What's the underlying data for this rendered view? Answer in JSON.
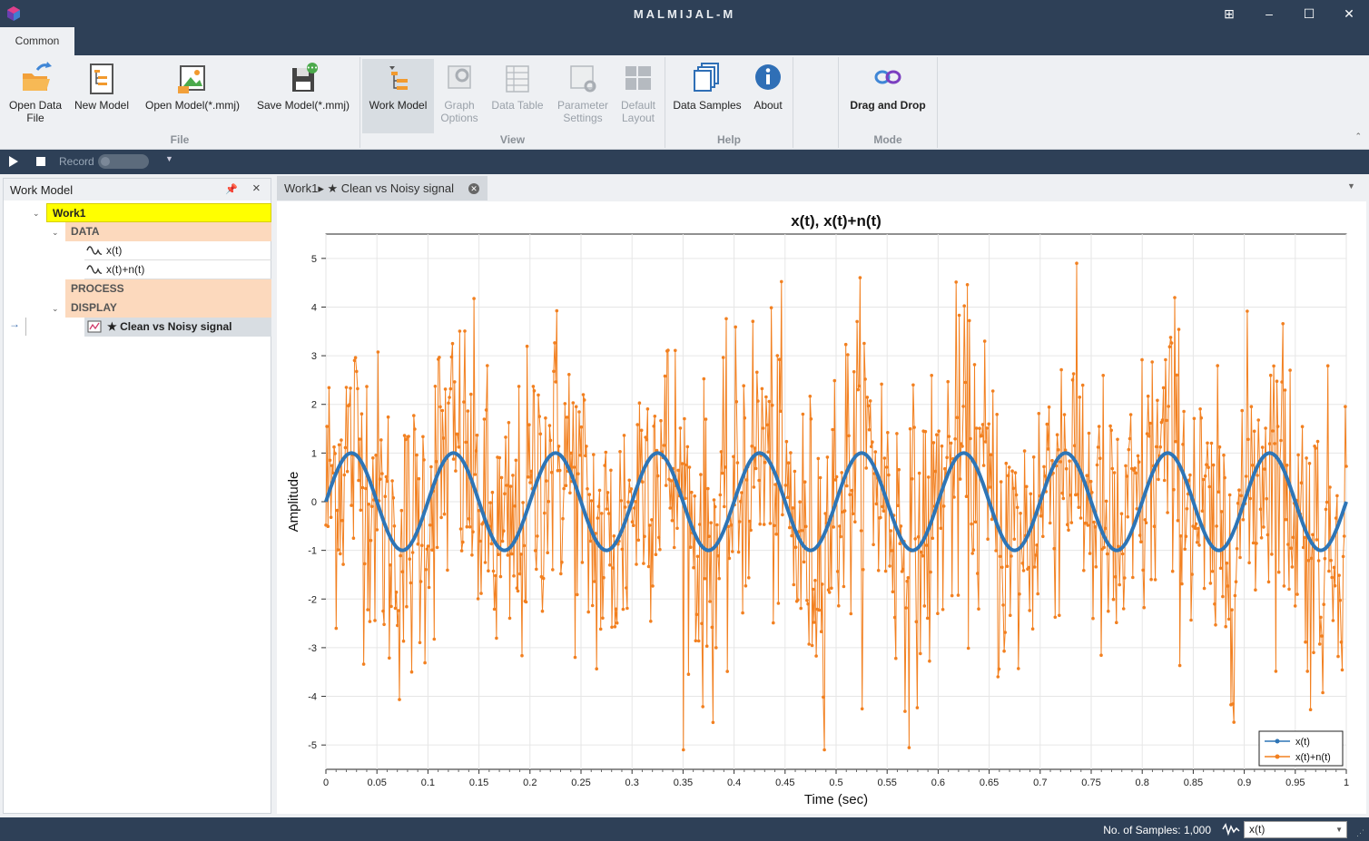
{
  "window": {
    "title": "MALMIJAL-M"
  },
  "ribbon": {
    "tab": "Common",
    "file_group": {
      "label": "File",
      "open_data": [
        "Open Data",
        "File"
      ],
      "new_model": "New Model",
      "open_model": "Open Model(*.mmj)",
      "save_model": "Save Model(*.mmj)"
    },
    "view_group": {
      "label": "View",
      "work_model": "Work Model",
      "graph_options": [
        "Graph",
        "Options"
      ],
      "data_table": "Data Table",
      "parameter_settings": [
        "Parameter",
        "Settings"
      ],
      "default_layout": [
        "Default",
        "Layout"
      ]
    },
    "help_group": {
      "label": "Help",
      "data_samples": "Data Samples",
      "about": "About"
    },
    "mode_group": {
      "label": "Mode",
      "drag_and_drop": "Drag and Drop"
    }
  },
  "record_bar": {
    "record_label": "Record"
  },
  "work_model_panel": {
    "title": "Work Model",
    "tree": {
      "root": "Work1",
      "data": "DATA",
      "data_items": [
        "x(t)",
        "x(t)+n(t)"
      ],
      "process": "PROCESS",
      "display": "DISPLAY",
      "display_items": [
        "★ Clean vs Noisy signal"
      ]
    }
  },
  "document_tab": {
    "label": "Work1▸ ★ Clean vs Noisy signal"
  },
  "status_bar": {
    "samples_text": "No. of Samples: 1,000",
    "selected_series": "x(t)"
  },
  "colors": {
    "titlebar": "#2e4057",
    "clean": "#2e75b6",
    "noisy": "#f28020",
    "work1_highlight": "#ffff00",
    "group_header": "#fcd9bd"
  },
  "chart_data": {
    "type": "line",
    "title": "x(t), x(t)+n(t)",
    "xlabel": "Time (sec)",
    "ylabel": "Amplitude",
    "xlim": [
      0,
      1
    ],
    "ylim": [
      -5.5,
      5.5
    ],
    "xticks": [
      "0",
      "0.05",
      "0.1",
      "0.15",
      "0.2",
      "0.25",
      "0.3",
      "0.35",
      "0.4",
      "0.45",
      "0.5",
      "0.55",
      "0.6",
      "0.65",
      "0.7",
      "0.75",
      "0.8",
      "0.85",
      "0.9",
      "0.95",
      "1"
    ],
    "yticks": [
      "5",
      "4",
      "3",
      "2",
      "1",
      "0",
      "-1",
      "-2",
      "-3",
      "-4",
      "-5"
    ],
    "grid": true,
    "legend_position": "bottom-right",
    "n_samples": 1000,
    "series": [
      {
        "name": "x(t)",
        "color": "#2e75b6",
        "x_range": [
          0,
          1
        ],
        "frequency_hz": 10,
        "amplitude": 1
      },
      {
        "name": "x(t)+n(t)",
        "color": "#f28020",
        "x_range": [
          0,
          1
        ],
        "note": "x(t) plus random noise, spans approximately -5 to 4.9"
      }
    ]
  }
}
